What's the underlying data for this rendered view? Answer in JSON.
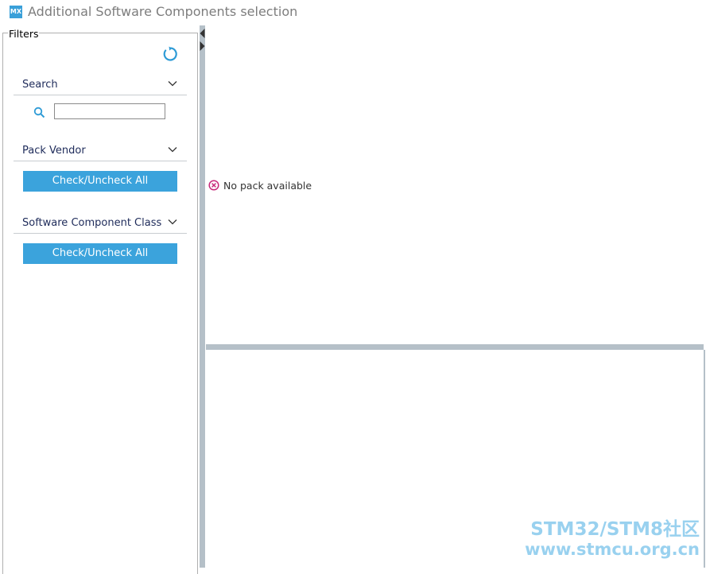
{
  "window": {
    "logo": "MX",
    "title": "Additional Software Components selection"
  },
  "filters": {
    "legend": "Filters",
    "refresh_icon": "refresh-icon",
    "sections": {
      "search": {
        "label": "Search",
        "input_value": "",
        "input_placeholder": ""
      },
      "pack_vendor": {
        "label": "Pack Vendor",
        "button": "Check/Uncheck All"
      },
      "component_class": {
        "label": "Software Component Class",
        "button": "Check/Uncheck All"
      }
    }
  },
  "main": {
    "status_icon": "error-circle-icon",
    "status_text": "No pack available"
  },
  "watermark": {
    "line1": "STM32/STM8社区",
    "line2": "www.stmcu.org.cn"
  },
  "colors": {
    "accent": "#3ba3dc",
    "splitter": "#b5c0c8",
    "error": "#c8297a",
    "title": "#7d7d7d"
  }
}
